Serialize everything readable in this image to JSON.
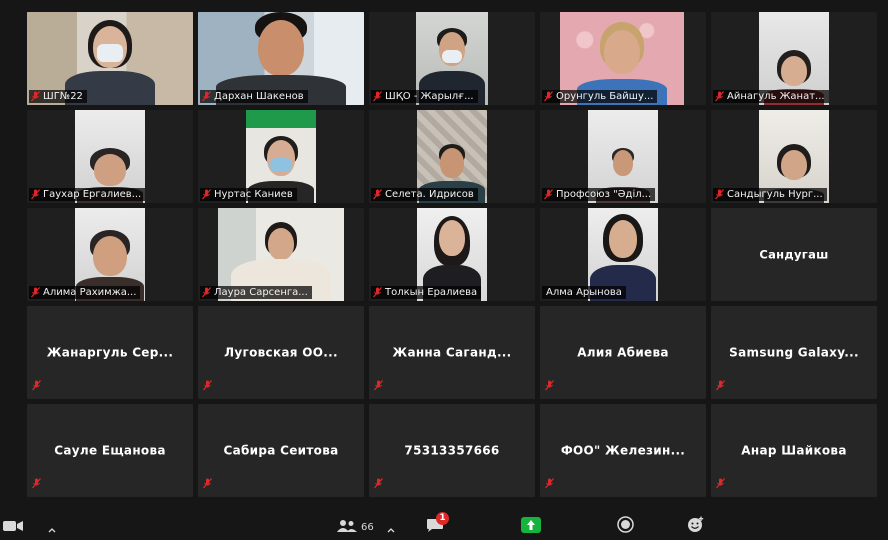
{
  "participants": [
    {
      "name": "ШГ№22",
      "video": true,
      "muted": true
    },
    {
      "name": "Дархан Шакенов",
      "video": true,
      "muted": true
    },
    {
      "name": "ШҚО - Жарылғ...",
      "video": true,
      "muted": true
    },
    {
      "name": "Орунгуль Байшу...",
      "video": true,
      "muted": true
    },
    {
      "name": "Айнагуль Жанат...",
      "video": true,
      "muted": true
    },
    {
      "name": "Гаухар Ергалиев...",
      "video": true,
      "muted": true
    },
    {
      "name": "Нуртас Каниев",
      "video": true,
      "muted": true
    },
    {
      "name": "Селета. Идрисов",
      "video": true,
      "muted": true
    },
    {
      "name": "Профсоюз \"Әділ...",
      "video": true,
      "muted": true
    },
    {
      "name": "Сандыгуль Нург...",
      "video": true,
      "muted": true
    },
    {
      "name": "Алима Рахимжа...",
      "video": true,
      "muted": true
    },
    {
      "name": "Лаура Сарсенга...",
      "video": true,
      "muted": true
    },
    {
      "name": "Толкын Ералиева",
      "video": true,
      "muted": true
    },
    {
      "name": "Алма Арынова",
      "video": true,
      "muted": false
    },
    {
      "name": "Сандугаш",
      "video": false,
      "muted": false
    },
    {
      "name": "Жанаргуль Сер...",
      "video": false,
      "muted": true
    },
    {
      "name": "Луговская ОО...",
      "video": false,
      "muted": true
    },
    {
      "name": "Жанна Саганд...",
      "video": false,
      "muted": true
    },
    {
      "name": "Алия Абиева",
      "video": false,
      "muted": true
    },
    {
      "name": "Samsung Galaxy...",
      "video": false,
      "muted": true
    },
    {
      "name": "Сауле Ещанова",
      "video": false,
      "muted": true
    },
    {
      "name": "Сабира Сеитова",
      "video": false,
      "muted": true
    },
    {
      "name": "75313357666",
      "video": false,
      "muted": true
    },
    {
      "name": "ФОО\" Железин...",
      "video": false,
      "muted": true
    },
    {
      "name": "Анар Шайкова",
      "video": false,
      "muted": true
    }
  ],
  "toolbar": {
    "participants_count": "66",
    "chat_badge": "1",
    "icons": [
      "video-icon",
      "caret-up-icon",
      "participants-icon",
      "chat-icon",
      "share-screen-icon",
      "record-icon",
      "reactions-icon"
    ]
  },
  "colors": {
    "background": "#161616",
    "tile": "#262626",
    "muted_mic": "#e02828",
    "share_green": "#16b33e"
  }
}
